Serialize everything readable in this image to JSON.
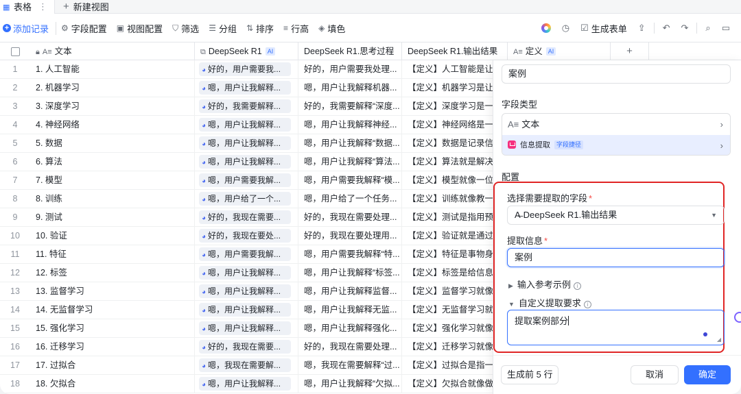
{
  "tabs": {
    "active": "表格",
    "new_view": "新建视图"
  },
  "toolbar": {
    "add_record": "添加记录",
    "items": [
      "字段配置",
      "视图配置",
      "筛选",
      "分组",
      "排序",
      "行高",
      "填色"
    ],
    "generate_form": "生成表单"
  },
  "columns": {
    "text": "文本",
    "deepseek_r1": "DeepSeek R1",
    "thinking": "DeepSeek R1.思考过程",
    "output": "DeepSeek R1.输出结果",
    "definition": "定义",
    "ai_badge": "AI"
  },
  "rows": [
    {
      "n": "1",
      "text": "1. 人工智能",
      "r1": "好的，用户需要我...",
      "think": "好的，用户需要我处理...",
      "out": "【定义】人工智能是让..."
    },
    {
      "n": "2",
      "text": "2. 机器学习",
      "r1": "嗯，用户让我解释...",
      "think": "嗯，用户让我解释机器...",
      "out": "【定义】机器学习是让..."
    },
    {
      "n": "3",
      "text": "3. 深度学习",
      "r1": "好的，我需要解释...",
      "think": "好的，我需要解释“深度...",
      "out": "【定义】深度学习是一..."
    },
    {
      "n": "4",
      "text": "4. 神经网络",
      "r1": "嗯，用户让我解释...",
      "think": "嗯，用户让我解释神经...",
      "out": "【定义】神经网络是一..."
    },
    {
      "n": "5",
      "text": "5. 数据",
      "r1": "嗯，用户让我解释...",
      "think": "嗯，用户让我解释“数据...",
      "out": "【定义】数据是记录信..."
    },
    {
      "n": "6",
      "text": "6. 算法",
      "r1": "嗯，用户让我解释...",
      "think": "嗯，用户让我解释“算法...",
      "out": "【定义】算法就是解决..."
    },
    {
      "n": "7",
      "text": "7. 模型",
      "r1": "嗯，用户需要我解...",
      "think": "嗯，用户需要我解释“模...",
      "out": "【定义】模型就像一位..."
    },
    {
      "n": "8",
      "text": "8. 训练",
      "r1": "嗯，用户给了一个...",
      "think": "嗯，用户给了一个任务...",
      "out": "【定义】训练就像教一..."
    },
    {
      "n": "9",
      "text": "9. 测试",
      "r1": "好的，我现在需要...",
      "think": "好的，我现在需要处理...",
      "out": "【定义】测试是指用预..."
    },
    {
      "n": "10",
      "text": "10. 验证",
      "r1": "好的，我现在要处...",
      "think": "好的，我现在要处理用...",
      "out": "【定义】验证就是通过..."
    },
    {
      "n": "11",
      "text": "11. 特征",
      "r1": "嗯，用户需要我解...",
      "think": "嗯，用户需要我解释“特...",
      "out": "【定义】特征是事物身..."
    },
    {
      "n": "12",
      "text": "12. 标签",
      "r1": "嗯，用户让我解释...",
      "think": "嗯，用户让我解释“标签...",
      "out": "【定义】标签是给信息..."
    },
    {
      "n": "13",
      "text": "13. 监督学习",
      "r1": "嗯，用户让我解释...",
      "think": "嗯，用户让我解释监督...",
      "out": "【定义】监督学习就像..."
    },
    {
      "n": "14",
      "text": "14. 无监督学习",
      "r1": "嗯，用户让我解释...",
      "think": "嗯，用户让我解释无监...",
      "out": "【定义】无监督学习就..."
    },
    {
      "n": "15",
      "text": "15. 强化学习",
      "r1": "嗯，用户让我解释...",
      "think": "嗯，用户让我解释强化...",
      "out": "【定义】强化学习就像..."
    },
    {
      "n": "16",
      "text": "16. 迁移学习",
      "r1": "好的，我现在需要...",
      "think": "好的，我现在需要处理...",
      "out": "【定义】迁移学习就像..."
    },
    {
      "n": "17",
      "text": "17. 过拟合",
      "r1": "嗯，我现在需要解...",
      "think": "嗯，我现在需要解释“过...",
      "out": "【定义】过拟合是指一..."
    },
    {
      "n": "18",
      "text": "18. 欠拟合",
      "r1": "嗯，用户让我解释...",
      "think": "嗯，用户让我解释“欠拟...",
      "out": "【定义】欠拟合就像做..."
    }
  ],
  "panel": {
    "field_name": "案例",
    "field_type_label": "字段类型",
    "type_text": "文本",
    "type_extract": "信息提取",
    "shortcut_badge": "字段捷径",
    "config_label": "配置",
    "select_field_label": "选择需要提取的字段",
    "selected_field": "DeepSeek R1.输出结果",
    "extract_info_label": "提取信息",
    "extract_info_value": "案例",
    "input_example": "输入参考示例",
    "custom_requirement": "自定义提取要求",
    "requirement_value": "提取案例部分",
    "preview_button": "生成前 5 行",
    "cancel": "取消",
    "confirm": "确定"
  },
  "colors": {
    "accent": "#3370ff",
    "highlight": "#e02424"
  }
}
